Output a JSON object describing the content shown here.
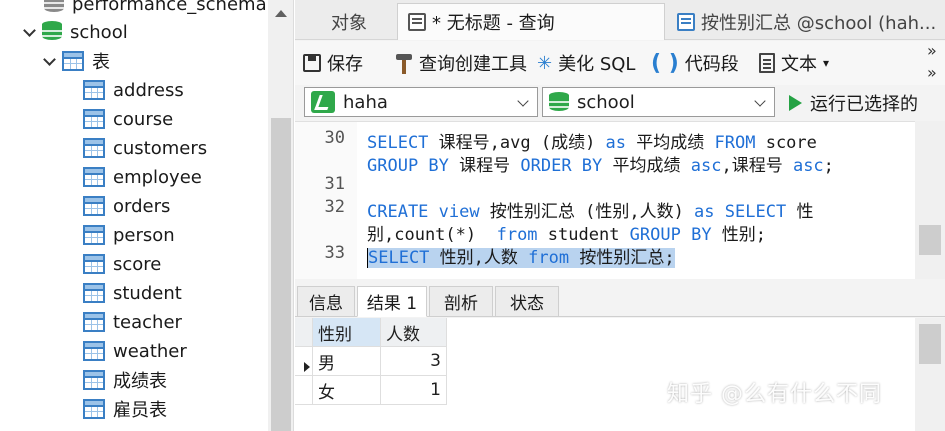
{
  "tree": {
    "partial_db": "performance_schema",
    "db": "school",
    "tables_group": "表",
    "tables": [
      "address",
      "course",
      "customers",
      "employee",
      "orders",
      "person",
      "score",
      "student",
      "teacher",
      "weather",
      "成绩表",
      "雇员表"
    ]
  },
  "tabs": [
    {
      "label": "对象"
    },
    {
      "label": "* 无标题 - 查询"
    },
    {
      "label": "按性别汇总 @school (hah..."
    }
  ],
  "toolbar": {
    "save": "保存",
    "query_builder": "查询创建工具",
    "beautify": "美化 SQL",
    "snippet": "代码段",
    "text": "文本",
    "text_arrow": "▾",
    "more": "»"
  },
  "selectors": {
    "connection": "haha",
    "database": "school",
    "run_selected": "运行已选择的"
  },
  "editor": {
    "lines": [
      {
        "no": "30",
        "parts": [
          [
            "kw",
            "SELECT"
          ],
          [
            "t",
            " 课程号,avg (成绩) "
          ],
          [
            "kw",
            "as"
          ],
          [
            "t",
            " 平均成绩 "
          ],
          [
            "kw",
            "FROM"
          ],
          [
            "t",
            " score"
          ]
        ]
      },
      {
        "no": "",
        "parts": [
          [
            "kw",
            "GROUP BY"
          ],
          [
            "t",
            " 课程号 "
          ],
          [
            "kw",
            "ORDER BY"
          ],
          [
            "t",
            " 平均成绩 "
          ],
          [
            "kw",
            "asc"
          ],
          [
            "t",
            ",课程号 "
          ],
          [
            "kw",
            "asc"
          ],
          [
            "t",
            ";"
          ]
        ]
      },
      {
        "no": "31",
        "parts": []
      },
      {
        "no": "32",
        "parts": [
          [
            "kw",
            "CREATE"
          ],
          [
            "t",
            " "
          ],
          [
            "kw",
            "view"
          ],
          [
            "t",
            " 按性别汇总 (性别,人数) "
          ],
          [
            "kw",
            "as"
          ],
          [
            "t",
            " "
          ],
          [
            "kw",
            "SELECT"
          ],
          [
            "t",
            " 性"
          ]
        ]
      },
      {
        "no": "",
        "parts": [
          [
            "t",
            "别,count(*)  "
          ],
          [
            "kw",
            "from"
          ],
          [
            "t",
            " student "
          ],
          [
            "kw",
            "GROUP BY"
          ],
          [
            "t",
            " 性别;"
          ]
        ]
      },
      {
        "no": "33",
        "parts": [
          [
            "kw",
            "SELECT"
          ],
          [
            "t",
            " 性别,人数 "
          ],
          [
            "kw",
            "from"
          ],
          [
            "t",
            " 按性别汇总;"
          ]
        ],
        "selected": true
      }
    ]
  },
  "result_tabs": [
    "信息",
    "结果 1",
    "剖析",
    "状态"
  ],
  "grid": {
    "columns": [
      "性别",
      "人数"
    ],
    "rows": [
      [
        "男",
        "3"
      ],
      [
        "女",
        "1"
      ]
    ]
  },
  "watermark": "知乎 @么有什么不同"
}
